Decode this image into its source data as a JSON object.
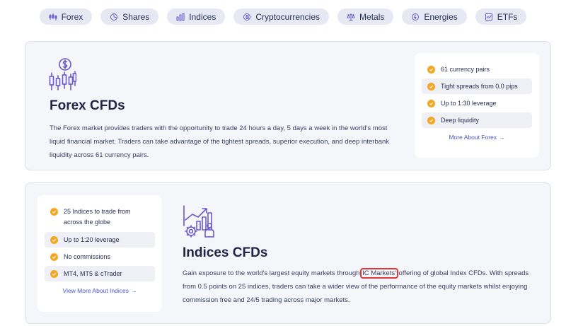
{
  "nav": {
    "pills": [
      {
        "label": "Forex",
        "icon": "forex-icon"
      },
      {
        "label": "Shares",
        "icon": "pie-chart-icon"
      },
      {
        "label": "Indices",
        "icon": "bar-chart-icon"
      },
      {
        "label": "Cryptocurrencies",
        "icon": "coin-icon"
      },
      {
        "label": "Metals",
        "icon": "scales-icon"
      },
      {
        "label": "Energies",
        "icon": "energy-icon"
      },
      {
        "label": "ETFs",
        "icon": "etf-icon"
      }
    ]
  },
  "forex": {
    "title": "Forex CFDs",
    "description": "The Forex market provides traders with the opportunity to trade 24 hours a day, 5 days a week in the world's most liquid financial market. Traders can take advantage of the tightest spreads, superior execution, and deep interbank liquidity across 61 currency pairs.",
    "features": [
      "61 currency pairs",
      "Tight spreads from 0.0 pips",
      "Up to 1:30 leverage",
      "Deep liquidity"
    ],
    "more_link": "More About Forex"
  },
  "indices": {
    "title": "Indices CFDs",
    "desc_before": "Gain exposure to the world's largest equity markets through ",
    "desc_highlight": "IC Markets'",
    "desc_after": " offering of global Index CFDs. With spreads from 0.5 points on 25 indices, traders can take a wider view of the performance of the equity markets whilst enjoying commission free and 24/5 trading across major markets.",
    "features": [
      "25 Indices to trade from across the globe",
      "Up to 1:20 leverage",
      "No commissions",
      "MT4, MT5 & cTrader"
    ],
    "more_link": "View More About Indices"
  },
  "colors": {
    "accent": "#6a5acd",
    "check": "#f5a623",
    "link": "#4a53c7",
    "highlight": "#e0353b"
  }
}
